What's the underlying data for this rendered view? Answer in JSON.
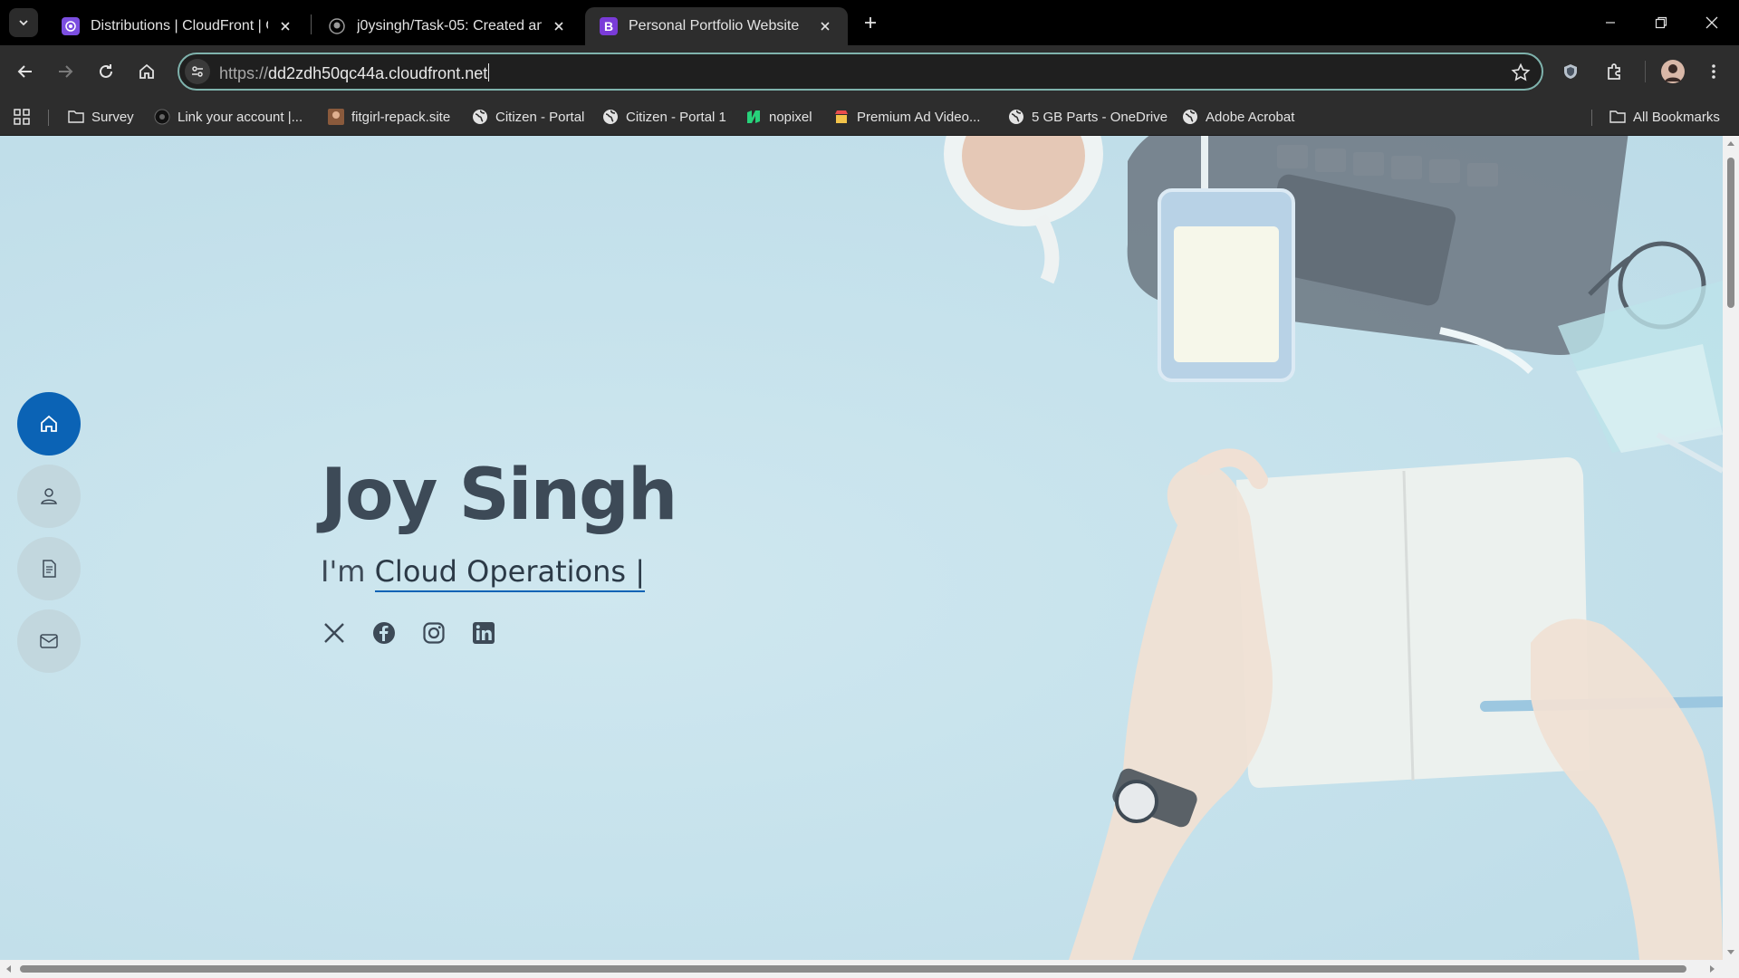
{
  "browser": {
    "tabs": [
      {
        "title": "Distributions | CloudFront | Global",
        "favicon": "cloudfront-icon",
        "active": false
      },
      {
        "title": "j0ysingh/Task-05: Created and configured",
        "favicon": "github-icon",
        "active": false
      },
      {
        "title": "Personal Portfolio Website",
        "favicon": "bootstrap-icon",
        "favicon_letter": "B",
        "active": true
      }
    ],
    "address": {
      "scheme": "https://",
      "host": "dd2zdh50qc44a.cloudfront.net"
    },
    "bookmarks": [
      {
        "label": "Survey",
        "icon": "folder-icon"
      },
      {
        "label": "Link your account |...",
        "icon": "globe-dark-icon"
      },
      {
        "label": "fitgirl-repack.site",
        "icon": "site-thumbnail-icon"
      },
      {
        "label": "Citizen - Portal",
        "icon": "globe-icon"
      },
      {
        "label": "Citizen - Portal 1",
        "icon": "globe-icon"
      },
      {
        "label": "nopixel",
        "icon": "nopixel-icon"
      },
      {
        "label": "Premium Ad Video...",
        "icon": "store-icon"
      },
      {
        "label": "5 GB Parts - OneDrive",
        "icon": "globe-icon"
      },
      {
        "label": "Adobe Acrobat",
        "icon": "globe-icon"
      }
    ],
    "all_bookmarks": "All Bookmarks"
  },
  "page": {
    "name": "Joy Singh",
    "intro_prefix": "I'm",
    "typed_role": "Cloud Operations |",
    "side_nav": [
      "home-icon",
      "person-icon",
      "resume-icon",
      "envelope-icon"
    ],
    "social_links": [
      "x-icon",
      "facebook-icon",
      "instagram-icon",
      "linkedin-icon"
    ],
    "colors": {
      "accent": "#0b63b5",
      "text": "#3d4a57",
      "background": "#c6e2ec"
    }
  }
}
